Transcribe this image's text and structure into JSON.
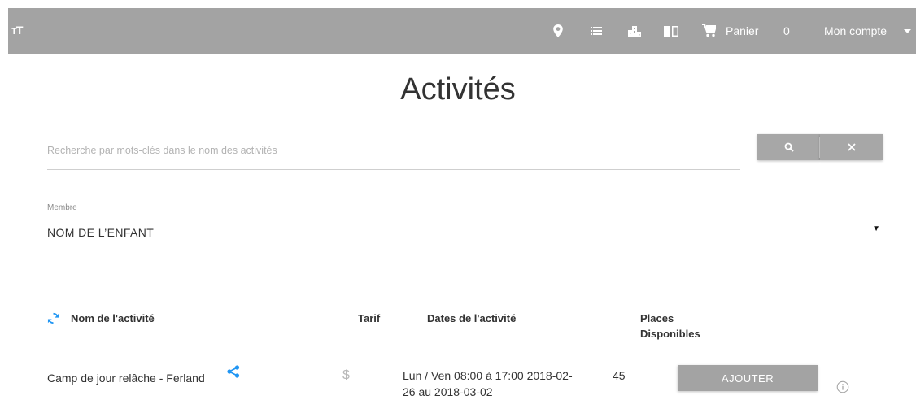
{
  "header": {
    "logo": "тT",
    "cart_label": "Panier",
    "cart_count": "0",
    "account_label": "Mon compte"
  },
  "page": {
    "title": "Activités"
  },
  "search": {
    "placeholder": "Recherche par mots-clés dans le nom des activités",
    "value": ""
  },
  "member": {
    "label": "Membre",
    "selected": "NOM DE L’ENFANT"
  },
  "table": {
    "headers": {
      "name": "Nom de l'activité",
      "tarif": "Tarif",
      "dates": "Dates de l'activité",
      "places_line1": "Places",
      "places_line2": "Disponibles"
    },
    "rows": [
      {
        "name": "Camp de jour relâche - Ferland",
        "tarif_symbol": "$",
        "dates_line1": "Lun / Ven 08:00 à 17:00 2018-02-",
        "dates_line2": "26 au 2018-03-02",
        "places": "45",
        "action": "AJOUTER"
      }
    ]
  },
  "colors": {
    "header_bg": "#a3a3a3",
    "accent": "#2196f3",
    "button_grey": "#a7a7a7"
  },
  "icons": [
    "location-icon",
    "list-icon",
    "building-icon",
    "book-icon",
    "cart-icon",
    "dropdown-arrow-icon",
    "search-icon",
    "close-icon",
    "refresh-icon",
    "share-icon",
    "info-icon"
  ]
}
